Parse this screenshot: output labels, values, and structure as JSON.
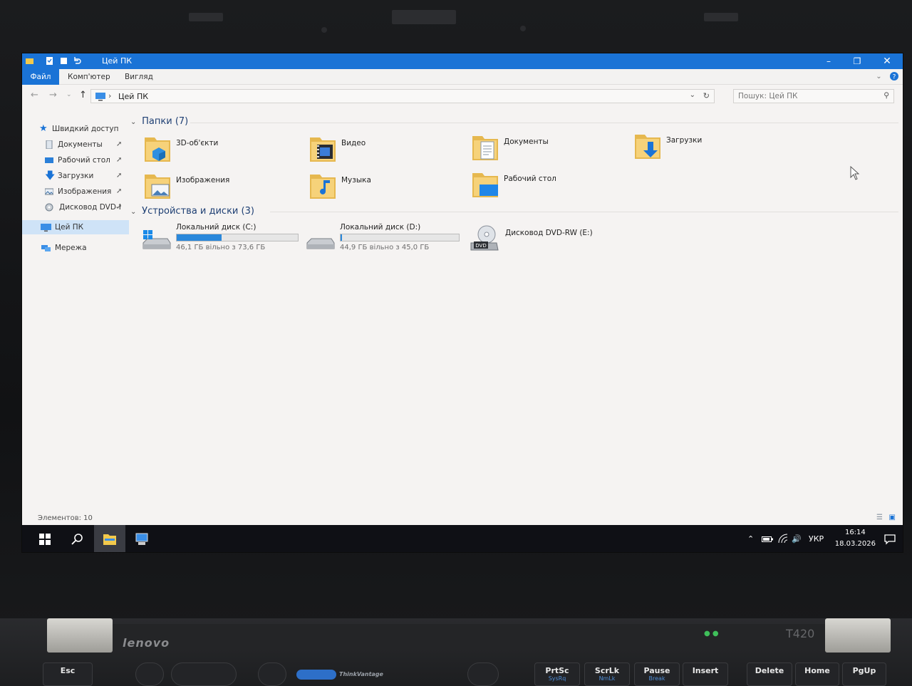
{
  "window": {
    "title": "Цей ПК",
    "tabs": [
      "Файл",
      "Комп'ютер",
      "Вигляд"
    ]
  },
  "address": {
    "path": "Цей ПК",
    "search_placeholder": "Пошук: Цей ПК"
  },
  "nav_pane": {
    "quick_access": "Швидкий доступ",
    "pinned": [
      "Документы",
      "Рабочий стол",
      "Загрузки",
      "Изображения",
      "Дисковод DVD-I"
    ],
    "this_pc": "Цей ПК",
    "network": "Мережа"
  },
  "folders": {
    "header": "Папки (7)",
    "items": [
      "3D-об'єкти",
      "Видео",
      "Документы",
      "Загрузки",
      "Изображения",
      "Музыка",
      "Рабочий стол"
    ]
  },
  "devices": {
    "header": "Устройства и диски (3)",
    "items": [
      {
        "name": "Локальний диск (C:)",
        "free_text": "46,1 ГБ вільно з 73,6 ГБ",
        "used_fraction": 0.37
      },
      {
        "name": "Локальний диск (D:)",
        "free_text": "44,9 ГБ вільно з 45,0 ГБ",
        "used_fraction": 0.01
      },
      {
        "name": "Дисковод DVD-RW (E:)"
      }
    ]
  },
  "status": {
    "items_count": "Элементов: 10"
  },
  "taskbar": {
    "language": "УКР",
    "time": "16:14",
    "date": "18.03.2026"
  },
  "laptop": {
    "brand": "lenovo",
    "model": "T420",
    "thinkvantage": "ThinkVantage",
    "keys": [
      {
        "label": "Esc"
      },
      {
        "label": "PrtSc",
        "sub": "SysRq"
      },
      {
        "label": "ScrLk",
        "sub": "NmLk"
      },
      {
        "label": "Pause",
        "sub": "Break"
      },
      {
        "label": "Insert"
      },
      {
        "label": "Delete"
      },
      {
        "label": "Home"
      },
      {
        "label": "PgUp"
      }
    ]
  },
  "colors": {
    "accent": "#1a73d6",
    "selection": "#cfe3f7",
    "drive_fill": "#2a88db",
    "folder_yellow": "#e6b84f"
  }
}
